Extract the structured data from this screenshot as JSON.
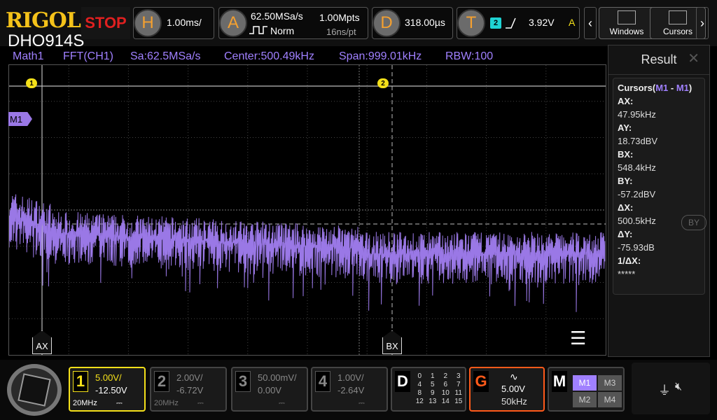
{
  "header": {
    "brand": "RIGOL",
    "model": "DHO914S",
    "run_state": "STOP"
  },
  "horizontal": {
    "letter": "H",
    "timebase": "1.00ms/"
  },
  "acquire": {
    "letter": "A",
    "sample_rate": "62.50MSa/s",
    "memory": "1.00Mpts",
    "mode": "Norm",
    "sample_period": "16ns/pt"
  },
  "delay": {
    "letter": "D",
    "value": "318.00µs"
  },
  "trigger": {
    "letter": "T",
    "source": "2",
    "level": "3.92V",
    "mode": "A"
  },
  "nav": {
    "windows_label": "Windows",
    "cursors_label": "Cursors"
  },
  "math_info": {
    "name": "Math1",
    "op": "FFT(CH1)",
    "sa": "Sa:62.5MSa/s",
    "center": "Center:500.49kHz",
    "span": "Span:999.01kHz",
    "rbw": "RBW:100"
  },
  "markers": {
    "m1_tag": "M1",
    "cursor_a": "1",
    "cursor_b": "2",
    "ax_label": "AX",
    "bx_label": "BX",
    "by_label": "BY"
  },
  "result": {
    "title": "Result",
    "cursor_header": "Cursors(",
    "cursor_m1a": "M1",
    "cursor_sep": " - ",
    "cursor_m1b": "M1",
    "cursor_close": ")",
    "rows": [
      {
        "k": "AX:",
        "v": "47.95kHz"
      },
      {
        "k": "AY:",
        "v": "18.73dBV"
      },
      {
        "k": "BX:",
        "v": "548.4kHz"
      },
      {
        "k": "BY:",
        "v": "-57.2dBV"
      },
      {
        "k": "ΔX:",
        "v": "500.5kHz"
      },
      {
        "k": "ΔY:",
        "v": "-75.93dB"
      },
      {
        "k": "1/ΔX:",
        "v": "*****"
      }
    ]
  },
  "channels": [
    {
      "num": "1",
      "scale": "5.00V/",
      "offset": "-12.50V",
      "bw": "20MHz",
      "color": "#f4e01a"
    },
    {
      "num": "2",
      "scale": "2.00V/",
      "offset": "-6.72V",
      "bw": "20MHz",
      "color": "#888888"
    },
    {
      "num": "3",
      "scale": "50.00mV/",
      "offset": "0.00V",
      "bw": "",
      "color": "#888888"
    },
    {
      "num": "4",
      "scale": "1.00V/",
      "offset": "-2.64V",
      "bw": "",
      "color": "#888888"
    }
  ],
  "digital": {
    "letter": "D",
    "nums": [
      "0",
      "1",
      "2",
      "3",
      "4",
      "5",
      "6",
      "7",
      "8",
      "9",
      "10",
      "11",
      "12",
      "13",
      "14",
      "15"
    ]
  },
  "generator": {
    "letter": "G",
    "amp": "5.00V",
    "freq": "50kHz"
  },
  "math_buttons": {
    "letter": "M",
    "m1": "M1",
    "m2": "M2",
    "m3": "M3",
    "m4": "M4"
  },
  "colors": {
    "trace": "#9a78e6",
    "accent": "#a080ff",
    "ch1": "#f4e01a",
    "gen": "#ff5a1a"
  }
}
